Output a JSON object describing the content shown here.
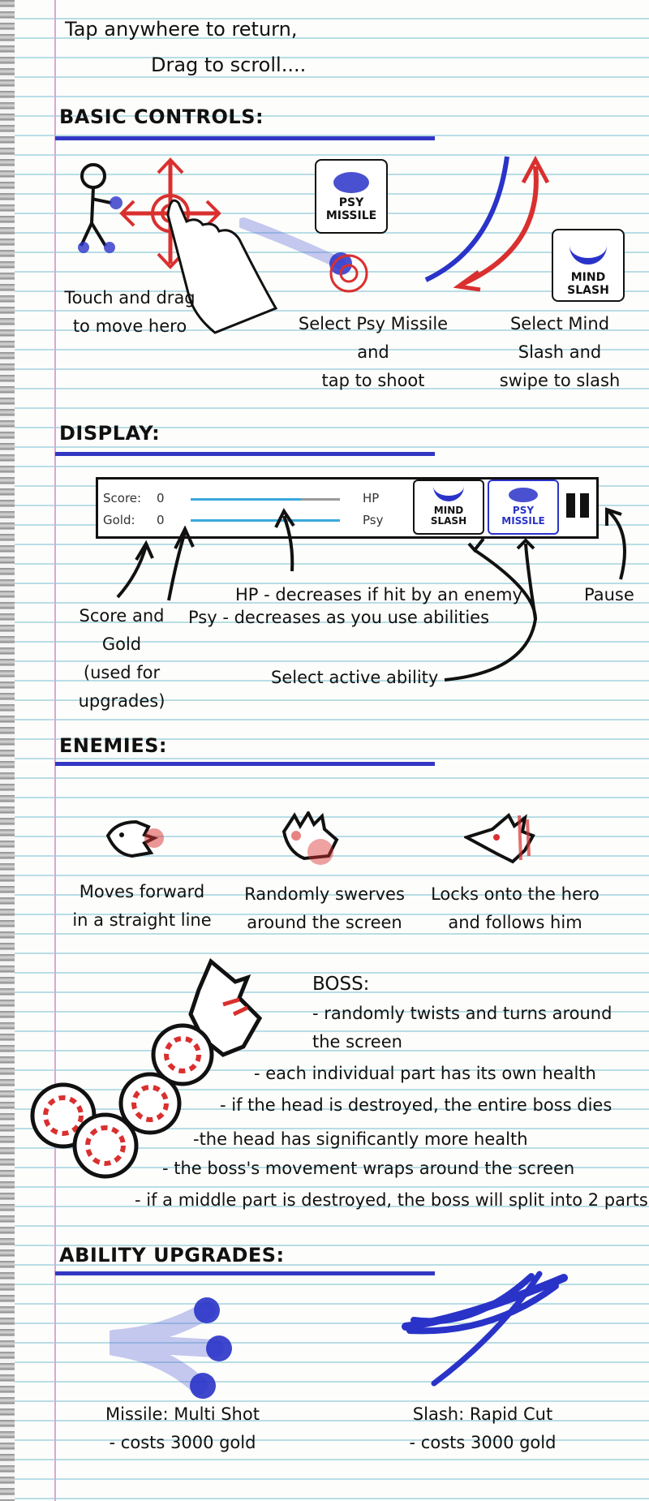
{
  "header": {
    "line1": "Tap anywhere to return,",
    "line2": "Drag to scroll...."
  },
  "basic_controls": {
    "heading": "BASIC CONTROLS:",
    "touch_line1": "Touch and drag",
    "touch_line2": "to move hero",
    "psy_button": {
      "line1": "PSY",
      "line2": "MISSILE"
    },
    "psy_line1": "Select Psy Missile",
    "psy_line2": "and",
    "psy_line3": "tap to shoot",
    "mind_button": {
      "line1": "MIND",
      "line2": "SLASH"
    },
    "mind_line1": "Select Mind",
    "mind_line2": "Slash and",
    "mind_line3": "swipe to slash"
  },
  "display": {
    "heading": "DISPLAY:",
    "hud": {
      "score_label": "Score:",
      "score_value": "0",
      "gold_label": "Gold:",
      "gold_value": "0",
      "hp_label": "HP",
      "psy_label": "Psy",
      "hp_fraction": 0.74,
      "psy_fraction": 1.0,
      "mind_button": {
        "line1": "MIND",
        "line2": "SLASH"
      },
      "psy_button": {
        "line1": "PSY",
        "line2": "MISSILE"
      }
    },
    "hp_note": "HP - decreases if hit by an enemy",
    "psy_note": "Psy - decreases as you use abilities",
    "pause_note": "Pause",
    "score_line1": "Score and",
    "score_line2": "Gold",
    "score_line3": "(used for upgrades)",
    "select_note": "Select active ability"
  },
  "enemies": {
    "heading": "ENEMIES:",
    "e1_line1": "Moves forward",
    "e1_line2": "in a straight line",
    "e2_line1": "Randomly swerves",
    "e2_line2": "around the screen",
    "e3_line1": "Locks onto the hero",
    "e3_line2": "and follows him",
    "boss_title": "BOSS:",
    "boss_lines": [
      "- randomly twists and turns around",
      "the screen",
      "- each individual part has its own health",
      "- if the head is destroyed, the entire boss dies",
      "-the head has significantly more health",
      "- the boss's movement wraps around the screen",
      "- if a middle part is destroyed, the boss will split into 2 parts"
    ]
  },
  "upgrades": {
    "heading": "ABILITY UPGRADES:",
    "missile_line1": "Missile: Multi Shot",
    "missile_line2": "- costs 3000 gold",
    "slash_line1": "Slash: Rapid Cut",
    "slash_line2": "- costs 3000 gold"
  },
  "colors": {
    "rule": "#3337c4",
    "ability_blue": "#2a33c8",
    "red_accent": "#d9302f",
    "line_blue": "#39a9dc"
  }
}
